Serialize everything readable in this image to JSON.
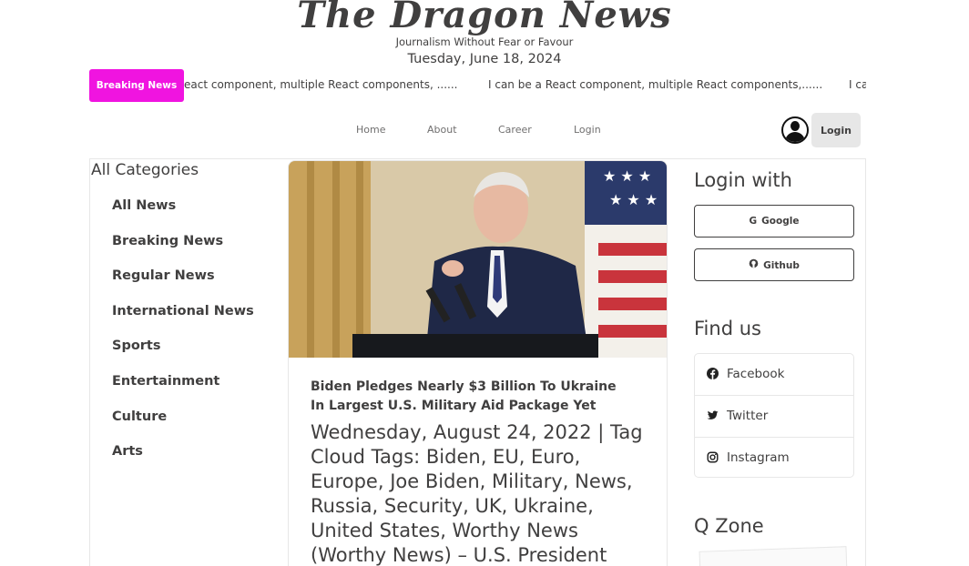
{
  "header": {
    "logo": "The Dragon News",
    "tagline": "Journalism Without Fear or Favour",
    "date": "Tuesday, June 18, 2024"
  },
  "ticker": {
    "button_label": "Breaking News",
    "items": [
      "eact component, multiple React components, ......",
      "I can be a React component, multiple React components,......",
      "I ca"
    ]
  },
  "nav": {
    "items": [
      "Home",
      "About",
      "Career",
      "Login"
    ],
    "login_button": "Login",
    "avatar_icon": "user-avatar-icon"
  },
  "categories": {
    "title": "All Categories",
    "items": [
      "All News",
      "Breaking News",
      "Regular News",
      "International News",
      "Sports",
      "Entertainment",
      "Culture",
      "Arts"
    ]
  },
  "article": {
    "title": "Biden Pledges Nearly $3 Billion To Ukraine In Largest U.S. Military Aid Package Yet",
    "description": "Wednesday, August 24, 2022 | Tag Cloud Tags: Biden, EU, Euro, Europe, Joe Biden, Military, News, Russia, Security, UK, Ukraine, United States, Worthy News (Worthy News) – U.S. President"
  },
  "sidebar": {
    "login_title": "Login with",
    "google_label": "Google",
    "github_label": "Github",
    "find_title": "Find us",
    "social": [
      "Facebook",
      "Twitter",
      "Instagram"
    ],
    "qzone_title": "Q Zone"
  },
  "colors": {
    "accent": "#f014e0",
    "text": "#403f3f",
    "muted": "#706f6f",
    "border": "#e7e7e7"
  }
}
